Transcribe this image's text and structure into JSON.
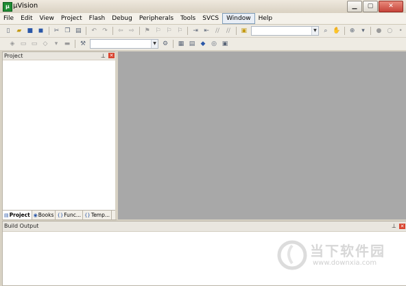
{
  "window": {
    "title": "µVision",
    "icon": "uvision-app-icon",
    "controls": [
      "minimize-icon",
      "maximize-icon",
      "close-icon"
    ]
  },
  "menubar": {
    "items": [
      "File",
      "Edit",
      "View",
      "Project",
      "Flash",
      "Debug",
      "Peripherals",
      "Tools",
      "SVCS",
      "Window",
      "Help"
    ],
    "active": "Window"
  },
  "toolbar1": {
    "icons": [
      "new-file-icon",
      "open-folder-icon",
      "save-icon",
      "save-all-icon",
      "cut-icon",
      "copy-icon",
      "paste-icon",
      "undo-icon",
      "redo-icon",
      "nav-back-icon",
      "nav-forward-icon",
      "bookmark-insert-icon",
      "bookmark-prev-icon",
      "bookmark-next-icon",
      "bookmark-clear-icon",
      "indent-icon",
      "unindent-icon",
      "comment-icon",
      "uncomment-icon",
      "find-in-files-icon",
      "find-icon",
      "incremental-find-icon",
      "start-debug-icon",
      "breakpoint-icon",
      "breakpoint-disable-icon"
    ],
    "find_combo_value": ""
  },
  "toolbar2": {
    "icons": [
      "translate-icon",
      "build-icon",
      "rebuild-icon",
      "batch-build-icon",
      "download-icon",
      "target-options-icon",
      "manage-components-icon",
      "file-extensions-icon",
      "pack-installer-icon",
      "select-device-icon",
      "run-time-env-icon"
    ],
    "target_combo_value": ""
  },
  "project_panel": {
    "title": "Project",
    "tabs": [
      {
        "label": "Project",
        "icon": "project-tab-icon"
      },
      {
        "label": "Books",
        "icon": "books-tab-icon"
      },
      {
        "label": "Func...",
        "icon": "functions-tab-icon"
      },
      {
        "label": "Temp...",
        "icon": "templates-tab-icon"
      }
    ]
  },
  "build_panel": {
    "title": "Build Output"
  },
  "watermark": {
    "brand": "当下软件园",
    "url": "www.downxia.com"
  },
  "colors": {
    "editor_bg": "#a8a8a8",
    "window_bg": "#d8d2c4",
    "panel_bg": "#ffffff"
  }
}
